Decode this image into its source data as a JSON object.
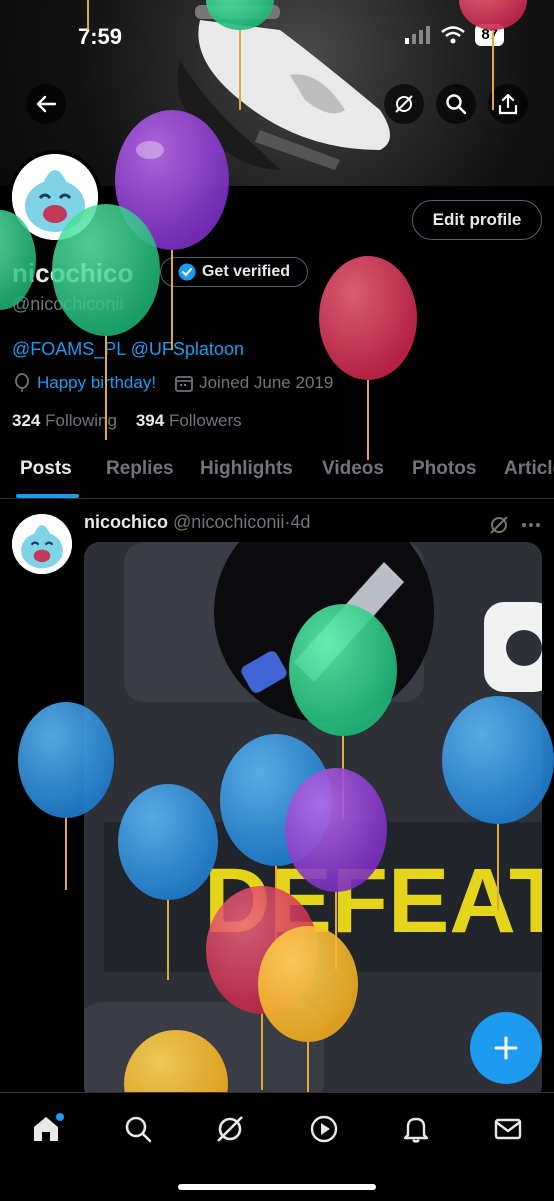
{
  "status_bar": {
    "time": "7:59",
    "battery": "87"
  },
  "profile": {
    "name": "nicochico",
    "handle": "@nicochiconii",
    "verify_label": "Get verified",
    "edit_label": "Edit profile",
    "bio": "@FOAMS_PL @UFSplatoon",
    "birthday": "Happy birthday!",
    "joined": "Joined June 2019",
    "following_count": "324",
    "following_label": "Following",
    "followers_count": "394",
    "followers_label": "Followers"
  },
  "tabs": [
    {
      "label": "Posts",
      "active": true
    },
    {
      "label": "Replies"
    },
    {
      "label": "Highlights"
    },
    {
      "label": "Videos"
    },
    {
      "label": "Photos"
    },
    {
      "label": "Articles"
    }
  ],
  "post": {
    "author": "nicochico",
    "handle": "@nicochiconii",
    "separator": "·",
    "time": "4d",
    "image_text": "DEFEAT"
  },
  "nav": [
    "home-icon",
    "search-icon",
    "grok-icon",
    "video-icon",
    "notifications-icon",
    "messages-icon"
  ],
  "colors": {
    "accent": "#1d9bf0",
    "background": "#000000",
    "secondary_text": "#71767b"
  }
}
